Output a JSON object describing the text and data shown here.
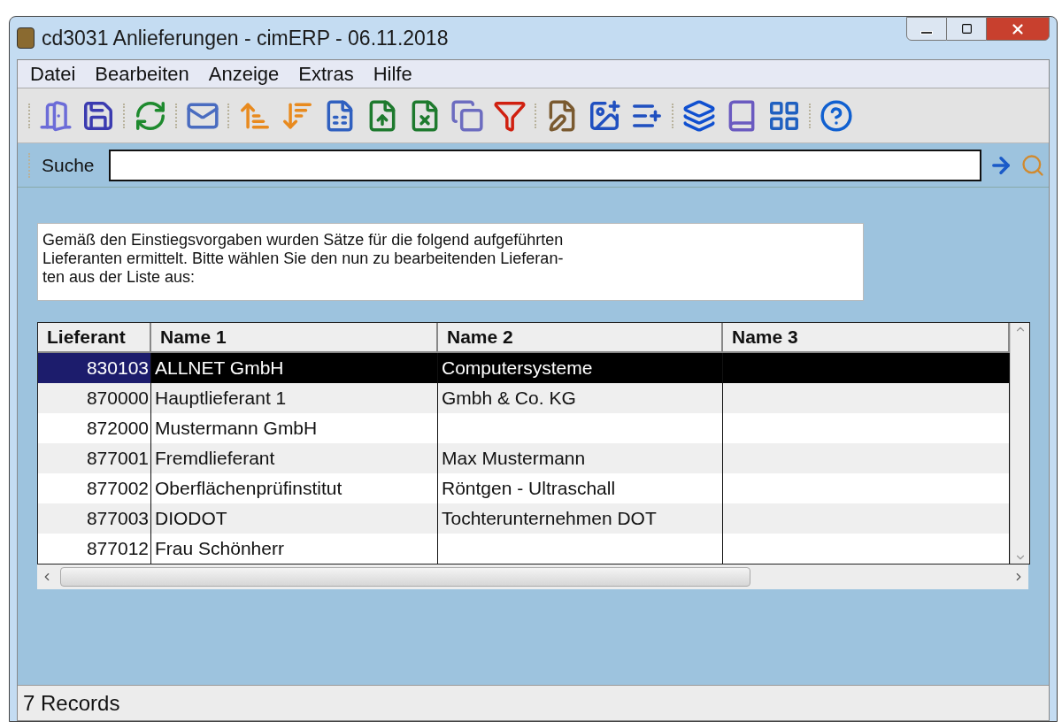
{
  "window": {
    "title": "cd3031 Anlieferungen - cimERP - 06.11.2018"
  },
  "menu": [
    "Datei",
    "Bearbeiten",
    "Anzeige",
    "Extras",
    "Hilfe"
  ],
  "search": {
    "label": "Suche"
  },
  "info_lines": [
    "Gemäß den Einstiegsvorgaben wurden Sätze für die folgend aufgeführten",
    "Lieferanten ermittelt. Bitte wählen Sie den nun zu bearbeitenden Lieferan-",
    "ten aus der Liste aus:"
  ],
  "table": {
    "columns": [
      "Lieferant",
      "Name 1",
      "Name 2",
      "Name 3"
    ],
    "rows": [
      {
        "cells": [
          "830103",
          "ALLNET GmbH",
          "Computersysteme",
          ""
        ],
        "selected": true
      },
      {
        "cells": [
          "870000",
          "Hauptlieferant 1",
          "Gmbh & Co. KG",
          ""
        ],
        "selected": false
      },
      {
        "cells": [
          "872000",
          "Mustermann GmbH",
          "",
          ""
        ],
        "selected": false
      },
      {
        "cells": [
          "877001",
          "Fremdlieferant",
          "Max Mustermann",
          ""
        ],
        "selected": false
      },
      {
        "cells": [
          "877002",
          "Oberflächenprüfinstitut",
          "Röntgen - Ultraschall",
          ""
        ],
        "selected": false
      },
      {
        "cells": [
          "877003",
          "DIODOT",
          "Tochterunternehmen DOT",
          ""
        ],
        "selected": false
      },
      {
        "cells": [
          "877012",
          "Frau Schönherr",
          "",
          ""
        ],
        "selected": false
      }
    ]
  },
  "status_bar": "7 Records"
}
